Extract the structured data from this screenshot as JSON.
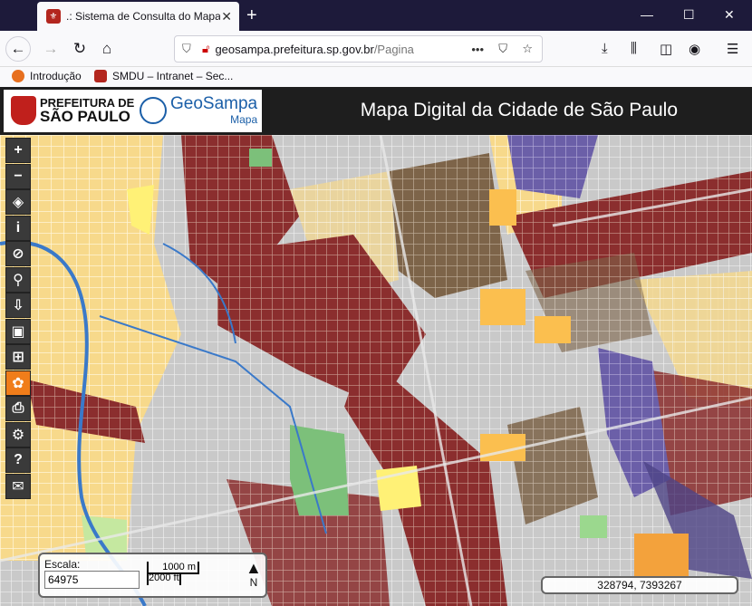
{
  "browser": {
    "tab_title": ".: Sistema de Consulta do Mapa",
    "url_domain": "geosampa.prefeitura.sp.gov.br",
    "url_path": "/Pagina",
    "bookmarks": [
      "Introdução",
      "SMDU – Intranet – Sec..."
    ]
  },
  "header": {
    "pref_line1": "PREFEITURA DE",
    "pref_line2": "SÃO PAULO",
    "brand": "GeoSampa",
    "brand_sub": "Mapa",
    "title": "Mapa Digital da Cidade de São Paulo"
  },
  "toolbar": {
    "icons": [
      "zoom-in-icon",
      "zoom-out-icon",
      "layers-icon",
      "info-icon",
      "no-draw-icon",
      "search-icon",
      "download-icon",
      "save-icon",
      "measure-icon",
      "film-icon",
      "print-icon",
      "settings-icon",
      "help-icon",
      "mail-icon"
    ]
  },
  "scale": {
    "label": "Escala:",
    "value": "64975",
    "bar_metric": "1000 m",
    "bar_imperial": "2000 ft",
    "north_label": "N"
  },
  "coords": "328794, 7393267",
  "colors": {
    "residential": "#f7d98b",
    "commercial": "#8b2e2e",
    "mixed": "#7d6449",
    "services": "#fbbf4f",
    "industrial": "#6b5fa8",
    "green": "#7cc07a",
    "road": "#c9c9c9",
    "river": "#3a79c9",
    "highlight": "#fff176"
  }
}
